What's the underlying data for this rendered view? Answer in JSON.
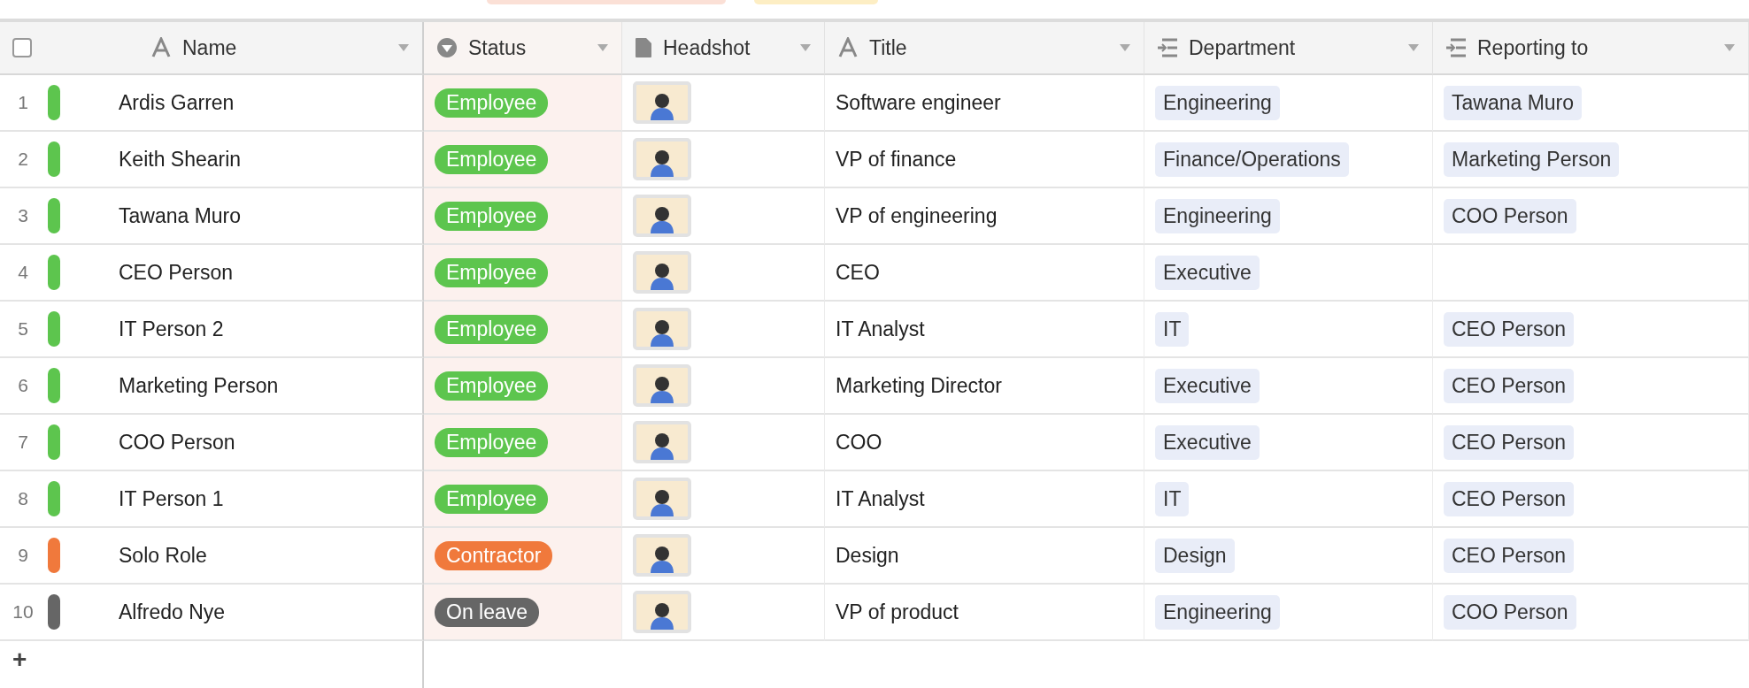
{
  "select_all": {
    "checked": false
  },
  "columns": [
    {
      "label": "Name",
      "kind": "text"
    },
    {
      "label": "Status",
      "kind": "select"
    },
    {
      "label": "Headshot",
      "kind": "file"
    },
    {
      "label": "Title",
      "kind": "text"
    },
    {
      "label": "Department",
      "kind": "link"
    },
    {
      "label": "Reporting to",
      "kind": "link"
    }
  ],
  "rows": [
    {
      "number": "1",
      "name": "Ardis Garren",
      "status": {
        "label": "Employee",
        "color": "#5dc54e"
      },
      "title": "Software engineer",
      "department": "Engineering",
      "reporting_to": "Tawana Muro"
    },
    {
      "number": "2",
      "name": "Keith Shearin",
      "status": {
        "label": "Employee",
        "color": "#5dc54e"
      },
      "title": "VP of finance",
      "department": "Finance/Operations",
      "reporting_to": "Marketing Person"
    },
    {
      "number": "3",
      "name": "Tawana Muro",
      "status": {
        "label": "Employee",
        "color": "#5dc54e"
      },
      "title": "VP of engineering",
      "department": "Engineering",
      "reporting_to": "COO Person"
    },
    {
      "number": "4",
      "name": "CEO Person",
      "status": {
        "label": "Employee",
        "color": "#5dc54e"
      },
      "title": "CEO",
      "department": "Executive"
    },
    {
      "number": "5",
      "name": "IT Person 2",
      "status": {
        "label": "Employee",
        "color": "#5dc54e"
      },
      "title": "IT Analyst",
      "department": "IT",
      "reporting_to": "CEO Person"
    },
    {
      "number": "6",
      "name": "Marketing Person",
      "status": {
        "label": "Employee",
        "color": "#5dc54e"
      },
      "title": "Marketing Director",
      "department": "Executive",
      "reporting_to": "CEO Person"
    },
    {
      "number": "7",
      "name": "COO Person",
      "status": {
        "label": "Employee",
        "color": "#5dc54e"
      },
      "title": "COO",
      "department": "Executive",
      "reporting_to": "CEO Person"
    },
    {
      "number": "8",
      "name": "IT Person 1",
      "status": {
        "label": "Employee",
        "color": "#5dc54e"
      },
      "title": "IT Analyst",
      "department": "IT",
      "reporting_to": "CEO Person"
    },
    {
      "number": "9",
      "name": "Solo Role",
      "status": {
        "label": "Contractor",
        "color": "#f0793c"
      },
      "title": "Design",
      "department": "Design",
      "reporting_to": "CEO Person"
    },
    {
      "number": "10",
      "name": "Alfredo Nye",
      "status": {
        "label": "On leave",
        "color": "#666666"
      },
      "title": "VP of product",
      "department": "Engineering",
      "reporting_to": "COO Person"
    }
  ],
  "add_row": {
    "label": "+"
  }
}
